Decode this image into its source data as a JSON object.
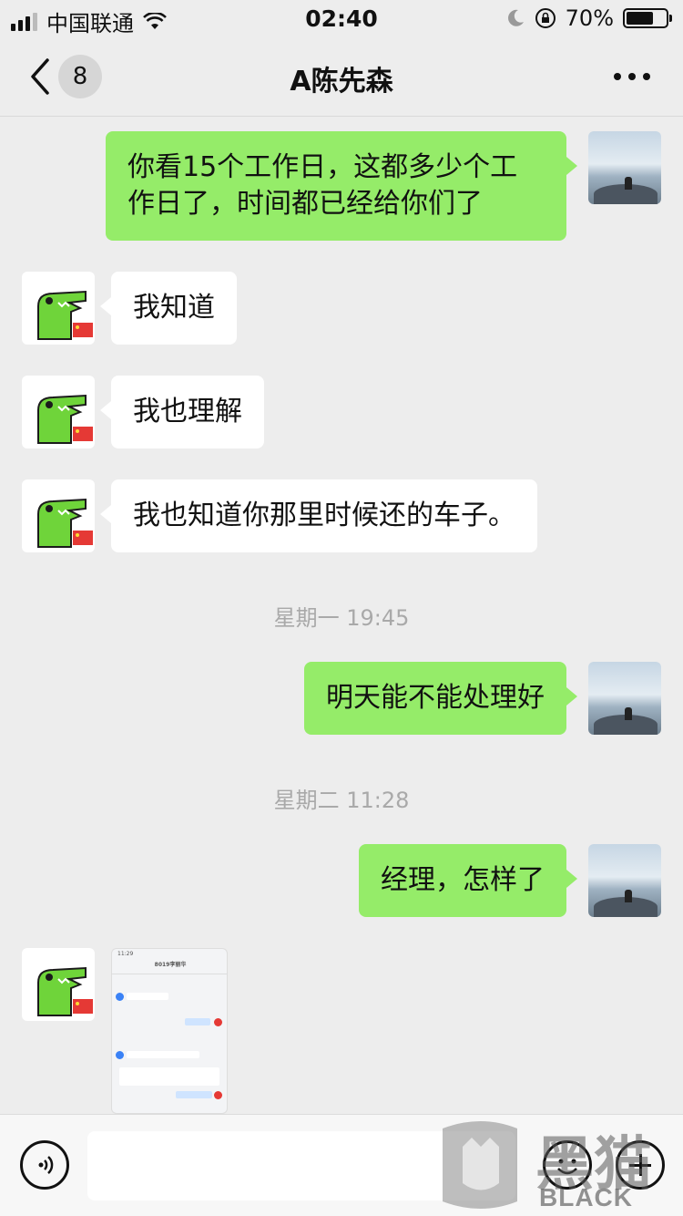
{
  "status_bar": {
    "carrier": "中国联通",
    "time": "02:40",
    "battery": "70%",
    "battery_level": 0.7
  },
  "nav": {
    "badge": "8",
    "title": "A陈先森"
  },
  "messages": [
    {
      "side": "out",
      "text": "你看15个工作日，这都多少个工作日了，时间都已经给你们了"
    },
    {
      "side": "in",
      "text": "我知道"
    },
    {
      "side": "in",
      "text": "我也理解"
    },
    {
      "side": "in",
      "text": "我也知道你那里时候还的车子。"
    },
    {
      "side": "out",
      "text": "明天能不能处理好"
    },
    {
      "side": "out",
      "text": "经理，怎样了"
    }
  ],
  "timestamps": [
    "星期一 19:45",
    "星期二 11:28"
  ],
  "screenshot_thumb": {
    "time": "11:29",
    "title": "8019李丽华"
  },
  "watermark": {
    "text_cn": "黑猫",
    "text_en": "BLACK CAT"
  },
  "icons": {
    "back": "chevron-left-icon",
    "more": "more-dots-icon",
    "voice": "voice-icon",
    "emoji": "emoji-icon",
    "plus": "plus-icon"
  },
  "colors": {
    "outgoing_bubble": "#95ec69",
    "incoming_bubble": "#ffffff",
    "background": "#ededed"
  }
}
